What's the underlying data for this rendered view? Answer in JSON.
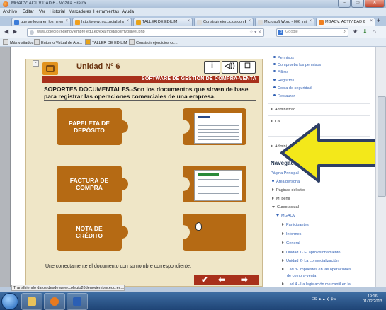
{
  "window": {
    "title": "MGACV: ACTIVIDAD 6 - Mozilla Firefox",
    "btn_min": "–",
    "btn_max": "▭",
    "btn_close": "✕"
  },
  "menu": [
    "Archivo",
    "Editar",
    "Ver",
    "Historial",
    "Marcadores",
    "Herramientas",
    "Ayuda"
  ],
  "tabs": [
    {
      "label": "que se logra en los nines c...",
      "color": "#3b7bd8"
    },
    {
      "label": "http://www.mo...ncial.shtml",
      "color": "#f0a020"
    },
    {
      "label": "TALLER DE EDILIM",
      "color": "#e8a319"
    },
    {
      "label": "Construir ejercicios con EDI...",
      "color": "#d9d9d9"
    },
    {
      "label": "Microsoft Word - 006_miPn...",
      "color": "#d9d9d9"
    },
    {
      "label": "MGACV: ACTIVIDAD 6",
      "color": "#f08020"
    }
  ],
  "tab_close": "×",
  "newtab": "+",
  "nav": {
    "back": "◀",
    "forward": "▶",
    "home": "⌂",
    "bookmark": "★",
    "download": "⬇",
    "url": "www.colegio26denoviembre.edu.ec/exa/mod/scorm/player.php",
    "url_star": "☆ ▾ ✕",
    "search_placeholder": "Google",
    "search_btn": "⌕",
    "google_letter": "g"
  },
  "bookmarks": [
    "Más visitados",
    "Entorno Virtual de Apr...",
    "TALLER DE EDILIM",
    "Construir ejercicios co..."
  ],
  "scorm": {
    "small_btn": "-",
    "unit": "Unidad Nº 6",
    "icons": [
      "i",
      "◁))",
      "☐"
    ],
    "banner": "SOFTWARE DE GESTIÓN DE COMPRA-VENTA",
    "description": "SOPORTES DOCUMENTALES.-Son los documentos que sirven de base para registrar las operaciones comerciales de una empresa.",
    "pieces": [
      [
        "PAPELETA DE",
        "DEPÓSITO"
      ],
      [
        "FACTURA DE",
        "COMPRA"
      ],
      [
        "NOTA DE",
        "CRÉDITO"
      ]
    ],
    "instruction": "Une correctamente el documento con su nombre correspondiente.",
    "nav_check": "✔",
    "nav_back": "⬅",
    "nav_next": "➡"
  },
  "sidebar": {
    "top_links": [
      "Permisos",
      "Comprueba los permisos",
      "Filtros",
      "Registros",
      "Copia de seguridad",
      "Restaurar"
    ],
    "sections": [
      "Administrac",
      "Ca",
      "Admini"
    ],
    "nav_title": "Navegación",
    "nav_controls": "⊟ ⊠",
    "nav_items": [
      {
        "label": "Página Principal",
        "kind": "plain"
      },
      {
        "label": "Área personal",
        "kind": "bullet"
      },
      {
        "label": "Páginas del sitio",
        "kind": "tri"
      },
      {
        "label": "Mi perfil",
        "kind": "tri"
      },
      {
        "label": "Curso actual",
        "kind": "down"
      },
      {
        "label": "MGACV",
        "kind": "down2"
      },
      {
        "label": "Participantes",
        "kind": "tri3"
      },
      {
        "label": "Informes",
        "kind": "tri3"
      },
      {
        "label": "General",
        "kind": "tri3"
      },
      {
        "label": "Unidad 1- El aprovisionamiento",
        "kind": "tri3"
      },
      {
        "label": "Unidad 2- La comercialización",
        "kind": "tri3"
      },
      {
        "label": "...ad 3- Impuestos en las operaciones",
        "kind": "tri3"
      },
      {
        "label": "de compra-venta",
        "kind": "plain3"
      },
      {
        "label": "...ad 4 - La legislación mercantil en la",
        "kind": "tri3"
      }
    ]
  },
  "status": "Transfiriendo datos desde www.colegio26denoviembre.edu.ec...",
  "taskbar": {
    "tray": "ES ◂▸ ▴ ◂) ⊕ ▸",
    "time": "19:16",
    "date": "01/12/2013"
  },
  "colors": {
    "accent_red": "#a8301b",
    "piece": "#b56a14",
    "arrow": "#f0e11a"
  }
}
